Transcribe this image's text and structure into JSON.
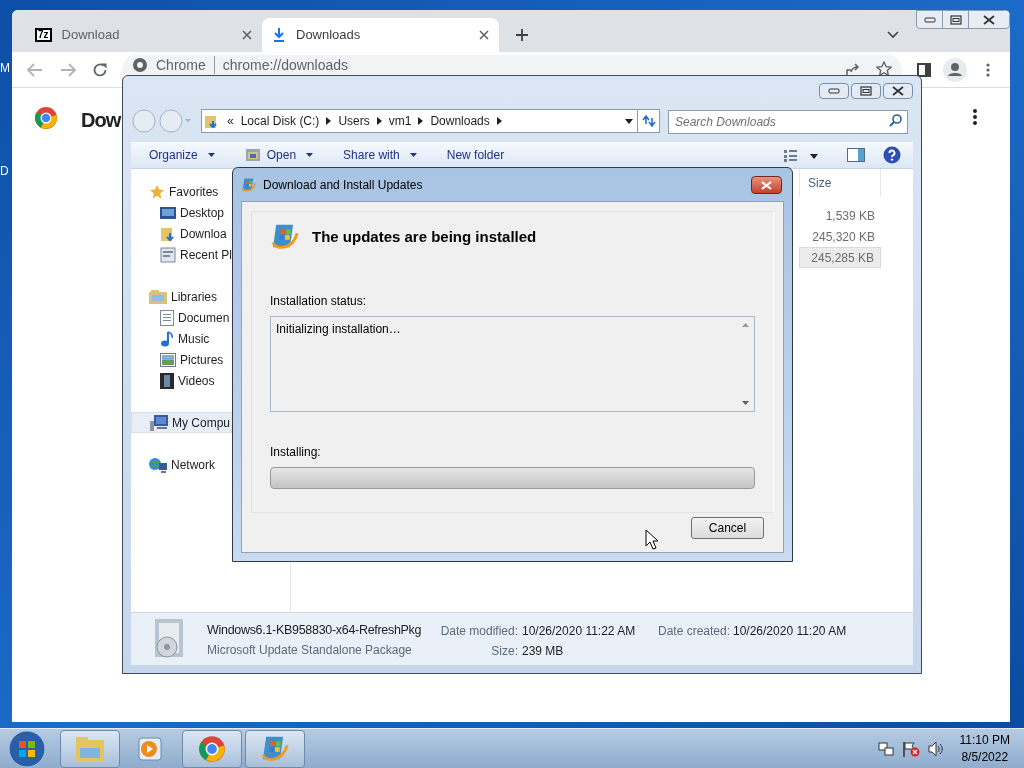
{
  "desktop": {
    "edge_labels": [
      "M",
      "D"
    ]
  },
  "browser": {
    "tabs": [
      {
        "title": "Download",
        "icon_text": "7z",
        "kind": "archive",
        "selected": false
      },
      {
        "title": "Downloads",
        "kind": "download",
        "selected": true
      }
    ],
    "address": {
      "site": "Chrome",
      "url": "chrome://downloads"
    },
    "page_title": "Dow"
  },
  "explorer": {
    "breadcrumb": [
      "«",
      "Local Disk (C:)",
      "Users",
      "vm1",
      "Downloads"
    ],
    "search": {
      "placeholder": "Search Downloads"
    },
    "toolbar": [
      {
        "label": "Organize",
        "kind": "menu"
      },
      {
        "label": "Open",
        "kind": "open"
      },
      {
        "label": "Share with",
        "kind": "menu"
      },
      {
        "label": "New folder",
        "kind": "plain"
      }
    ],
    "nav": [
      {
        "label": "Favorites",
        "kind": "star",
        "selected": false,
        "children": [
          {
            "label": "Desktop",
            "kind": "desktop",
            "selected": false
          },
          {
            "label": "Downloa",
            "kind": "download-folder",
            "selected": false
          },
          {
            "label": "Recent Pl",
            "kind": "recent",
            "selected": false
          }
        ]
      },
      {
        "label": "Libraries",
        "kind": "library",
        "selected": false,
        "children": [
          {
            "label": "Documen",
            "kind": "document",
            "selected": false
          },
          {
            "label": "Music",
            "kind": "music",
            "selected": false
          },
          {
            "label": "Pictures",
            "kind": "pictures",
            "selected": false
          },
          {
            "label": "Videos",
            "kind": "videos",
            "selected": false
          }
        ]
      },
      {
        "label": "My Compu",
        "kind": "computer",
        "selected": true
      },
      {
        "label": "Network",
        "kind": "network",
        "selected": false
      }
    ],
    "columns": [
      "Size"
    ],
    "rows": [
      {
        "size": "1,539 KB",
        "selected": false
      },
      {
        "size": "245,320 KB",
        "selected": false
      },
      {
        "size": "245,285 KB",
        "selected": true
      }
    ],
    "details": {
      "name": "Windows6.1-KB958830-x64-RefreshPkg",
      "type": "Microsoft Update Standalone Package",
      "modified_label": "Date modified:",
      "modified": "10/26/2020 11:22 AM",
      "created_label": "Date created:",
      "created": "10/26/2020 11:20 AM",
      "size_label": "Size:",
      "size": "239 MB"
    }
  },
  "dialog": {
    "title": "Download and Install Updates",
    "heading": "The updates are being installed",
    "status_label": "Installation status:",
    "status_text": "Initializing installation…",
    "progress_label": "Installing:",
    "level": 0,
    "buttons": [
      "Cancel"
    ]
  },
  "taskbar": {
    "items": [
      {
        "kind": "explorer",
        "running": true
      },
      {
        "kind": "media",
        "running": false
      },
      {
        "kind": "chrome",
        "running": true
      },
      {
        "kind": "update",
        "running": true
      }
    ],
    "clock": {
      "time": "11:10 PM",
      "date": "8/5/2022"
    }
  }
}
